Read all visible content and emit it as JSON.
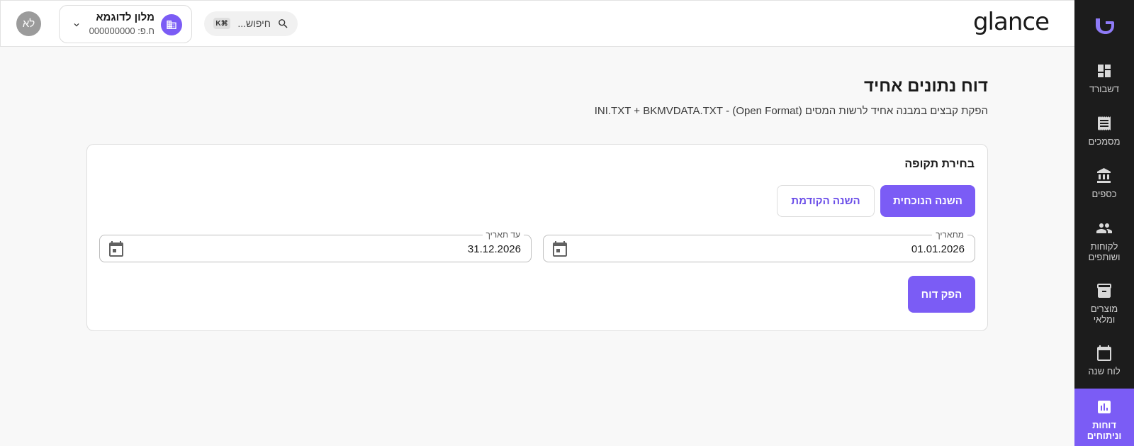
{
  "header": {
    "brand": "glance",
    "search_placeholder": "חיפוש...",
    "search_shortcut": "K⌘",
    "business_name": "מלון לדוגמא",
    "business_id": "ח.פ: 000000000",
    "avatar_initials": "לא"
  },
  "sidebar": {
    "items": [
      {
        "label": "דשבורד",
        "icon": "dashboard-icon"
      },
      {
        "label": "מסמכים",
        "icon": "receipt-icon"
      },
      {
        "label": "כספים",
        "icon": "bank-icon"
      },
      {
        "label": "לקוחות ושותפים",
        "icon": "people-icon"
      },
      {
        "label": "מוצרים ומלאי",
        "icon": "archive-icon"
      },
      {
        "label": "לוח שנה",
        "icon": "calendar-icon"
      },
      {
        "label": "דוחות וניתוחים",
        "icon": "bar-chart-icon",
        "active": true
      }
    ]
  },
  "main": {
    "title": "דוח נתונים אחיד",
    "subtitle": "הפקת קבצים במבנה אחיד לרשות המסים (Open Format) - INI.TXT + BKMVDATA.TXT",
    "card": {
      "title": "בחירת תקופה",
      "current_year_label": "השנה הנוכחית",
      "previous_year_label": "השנה הקודמת",
      "from_date": {
        "label": "מתאריך",
        "value": "01.01.2026"
      },
      "to_date": {
        "label": "עד תאריך",
        "value": "31.12.2026"
      },
      "generate_label": "הפק דוח"
    }
  },
  "colors": {
    "accent": "#7b5cf5",
    "sidebar_bg": "#1c1c1c"
  }
}
